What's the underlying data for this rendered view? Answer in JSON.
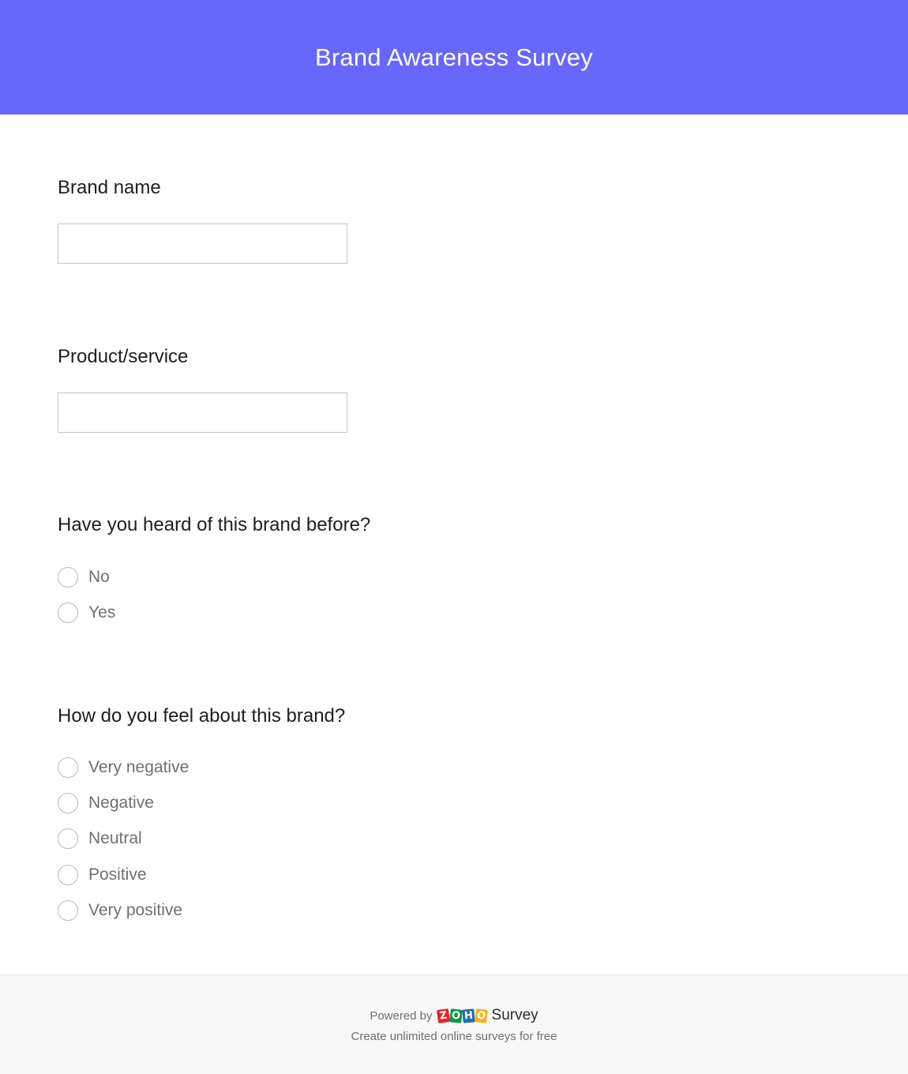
{
  "header": {
    "title": "Brand Awareness Survey",
    "background_color": "#6767fd"
  },
  "questions": [
    {
      "label": "Brand name",
      "type": "text",
      "value": "",
      "placeholder": ""
    },
    {
      "label": "Product/service",
      "type": "text",
      "value": "",
      "placeholder": ""
    },
    {
      "label": "Have you heard of this brand before?",
      "type": "radio",
      "options": [
        "No",
        "Yes"
      ],
      "selected": null
    },
    {
      "label": "How do you feel about this brand?",
      "type": "radio",
      "options": [
        "Very negative",
        "Negative",
        "Neutral",
        "Positive",
        "Very positive"
      ],
      "selected": null
    }
  ],
  "footer": {
    "powered_by": "Powered by",
    "logo_letters": [
      "Z",
      "O",
      "H",
      "O"
    ],
    "logo_colors": [
      "#e42527",
      "#089949",
      "#226db4",
      "#f9b21d"
    ],
    "product_name": "Survey",
    "tagline": "Create unlimited online surveys for free"
  }
}
